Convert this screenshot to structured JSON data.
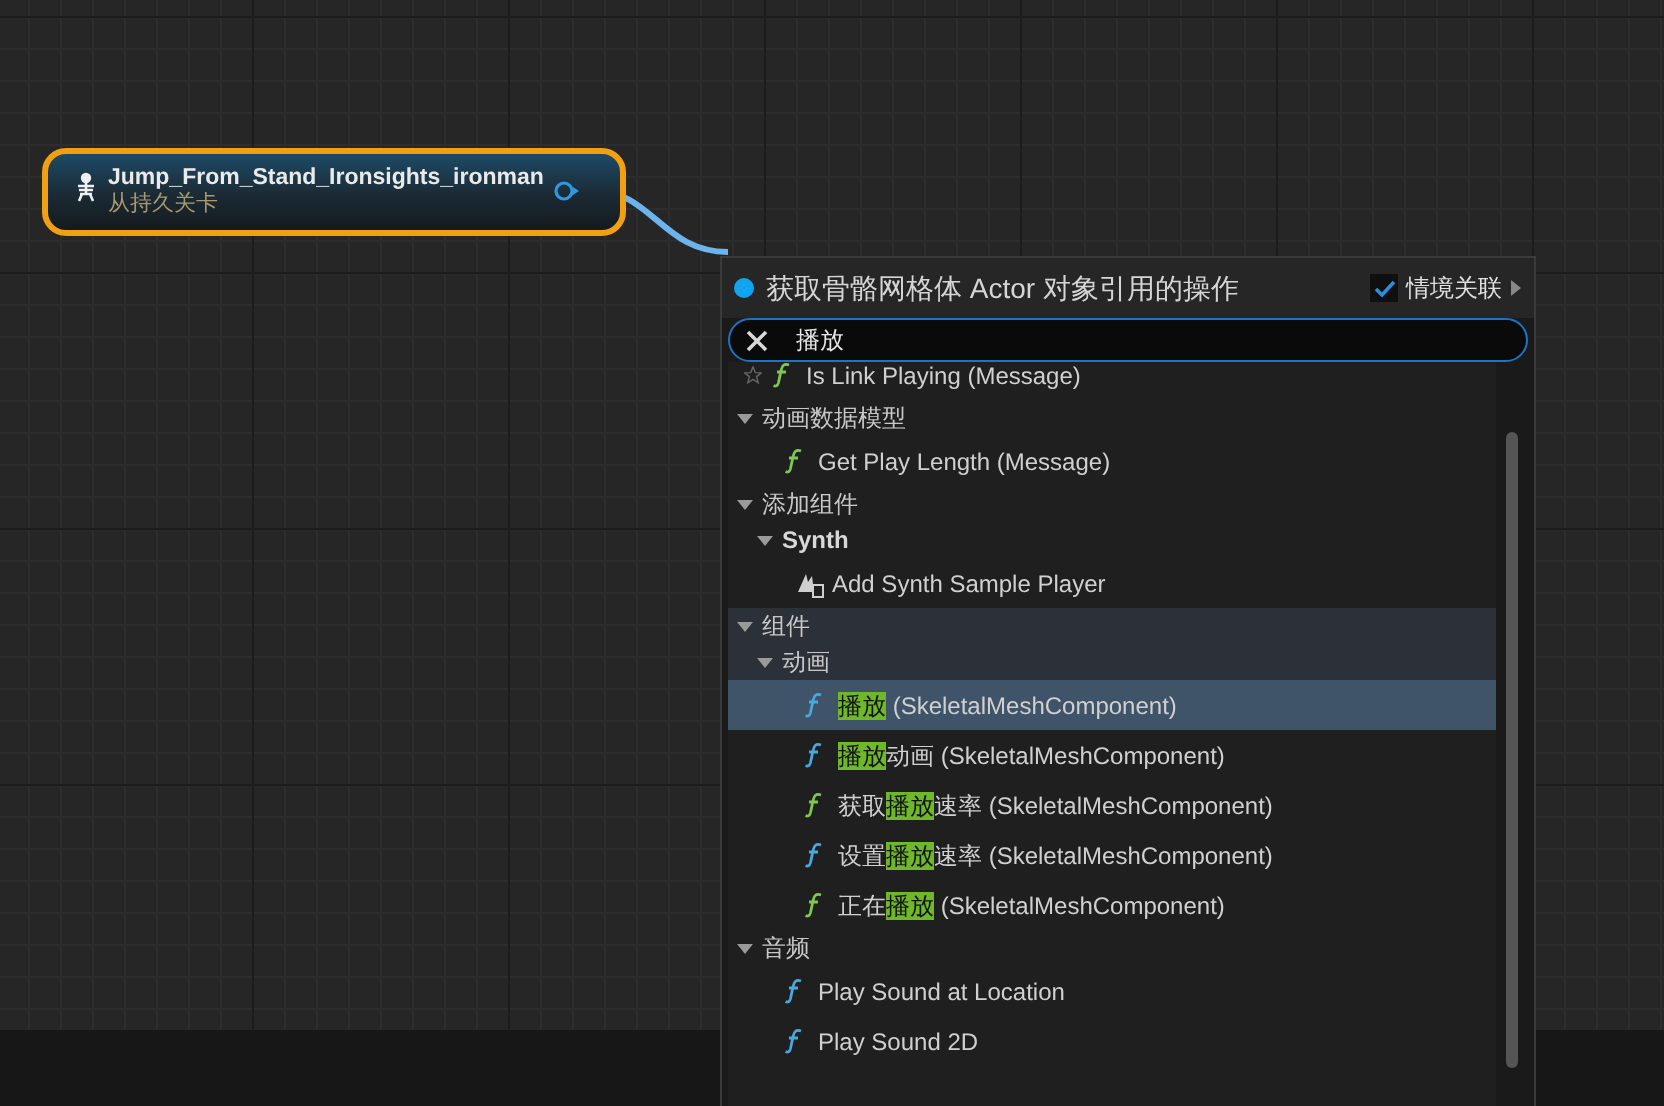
{
  "node": {
    "title": "Jump_From_Stand_Ironsights_ironman",
    "subtitle": "从持久关卡"
  },
  "menu": {
    "title": "获取骨骼网格体 Actor 对象引用的操作",
    "context_sensitive": {
      "label": "情境关联",
      "checked": true
    },
    "search": {
      "value": "播放"
    },
    "items": [
      {
        "kind": "function",
        "label": "Is Link Playing (Message)",
        "color": "#7ec850",
        "favorite": false,
        "selected": false
      },
      {
        "kind": "category",
        "label": "动画数据模型",
        "bold": false,
        "active": false,
        "expanded": true,
        "children": [
          {
            "kind": "function",
            "label": "Get Play Length (Message)",
            "color": "#7ec850",
            "selected": false
          }
        ]
      },
      {
        "kind": "category",
        "label": "添加组件",
        "bold": false,
        "active": false,
        "expanded": true,
        "children": [
          {
            "kind": "category",
            "label": "Synth",
            "bold": true,
            "active": false,
            "expanded": true,
            "children": [
              {
                "kind": "component",
                "label": "Add Synth Sample Player",
                "selected": false
              }
            ]
          }
        ]
      },
      {
        "kind": "category",
        "label": "组件",
        "bold": false,
        "active": true,
        "expanded": true,
        "children": [
          {
            "kind": "category",
            "label": "动画",
            "bold": false,
            "active": true,
            "expanded": true,
            "children": [
              {
                "kind": "function",
                "match": "播放",
                "after": " (SkeletalMeshComponent)",
                "color": "#4aa8e0",
                "selected": true
              },
              {
                "kind": "function",
                "match": "播放",
                "after": "动画 (SkeletalMeshComponent)",
                "color": "#4aa8e0",
                "selected": false
              },
              {
                "kind": "function",
                "before": "获取",
                "match": "播放",
                "after": "速率 (SkeletalMeshComponent)",
                "color": "#7ec850",
                "selected": false
              },
              {
                "kind": "function",
                "before": "设置",
                "match": "播放",
                "after": "速率 (SkeletalMeshComponent)",
                "color": "#4aa8e0",
                "selected": false
              },
              {
                "kind": "function",
                "before": "正在",
                "match": "播放",
                "after": " (SkeletalMeshComponent)",
                "color": "#7ec850",
                "selected": false
              }
            ]
          }
        ]
      },
      {
        "kind": "category",
        "label": "音频",
        "bold": false,
        "active": false,
        "expanded": true,
        "children": [
          {
            "kind": "function",
            "label": "Play Sound at Location",
            "color": "#4aa8e0",
            "selected": false
          },
          {
            "kind": "function",
            "label": "Play Sound 2D",
            "color": "#4aa8e0",
            "selected": false
          }
        ]
      }
    ]
  }
}
